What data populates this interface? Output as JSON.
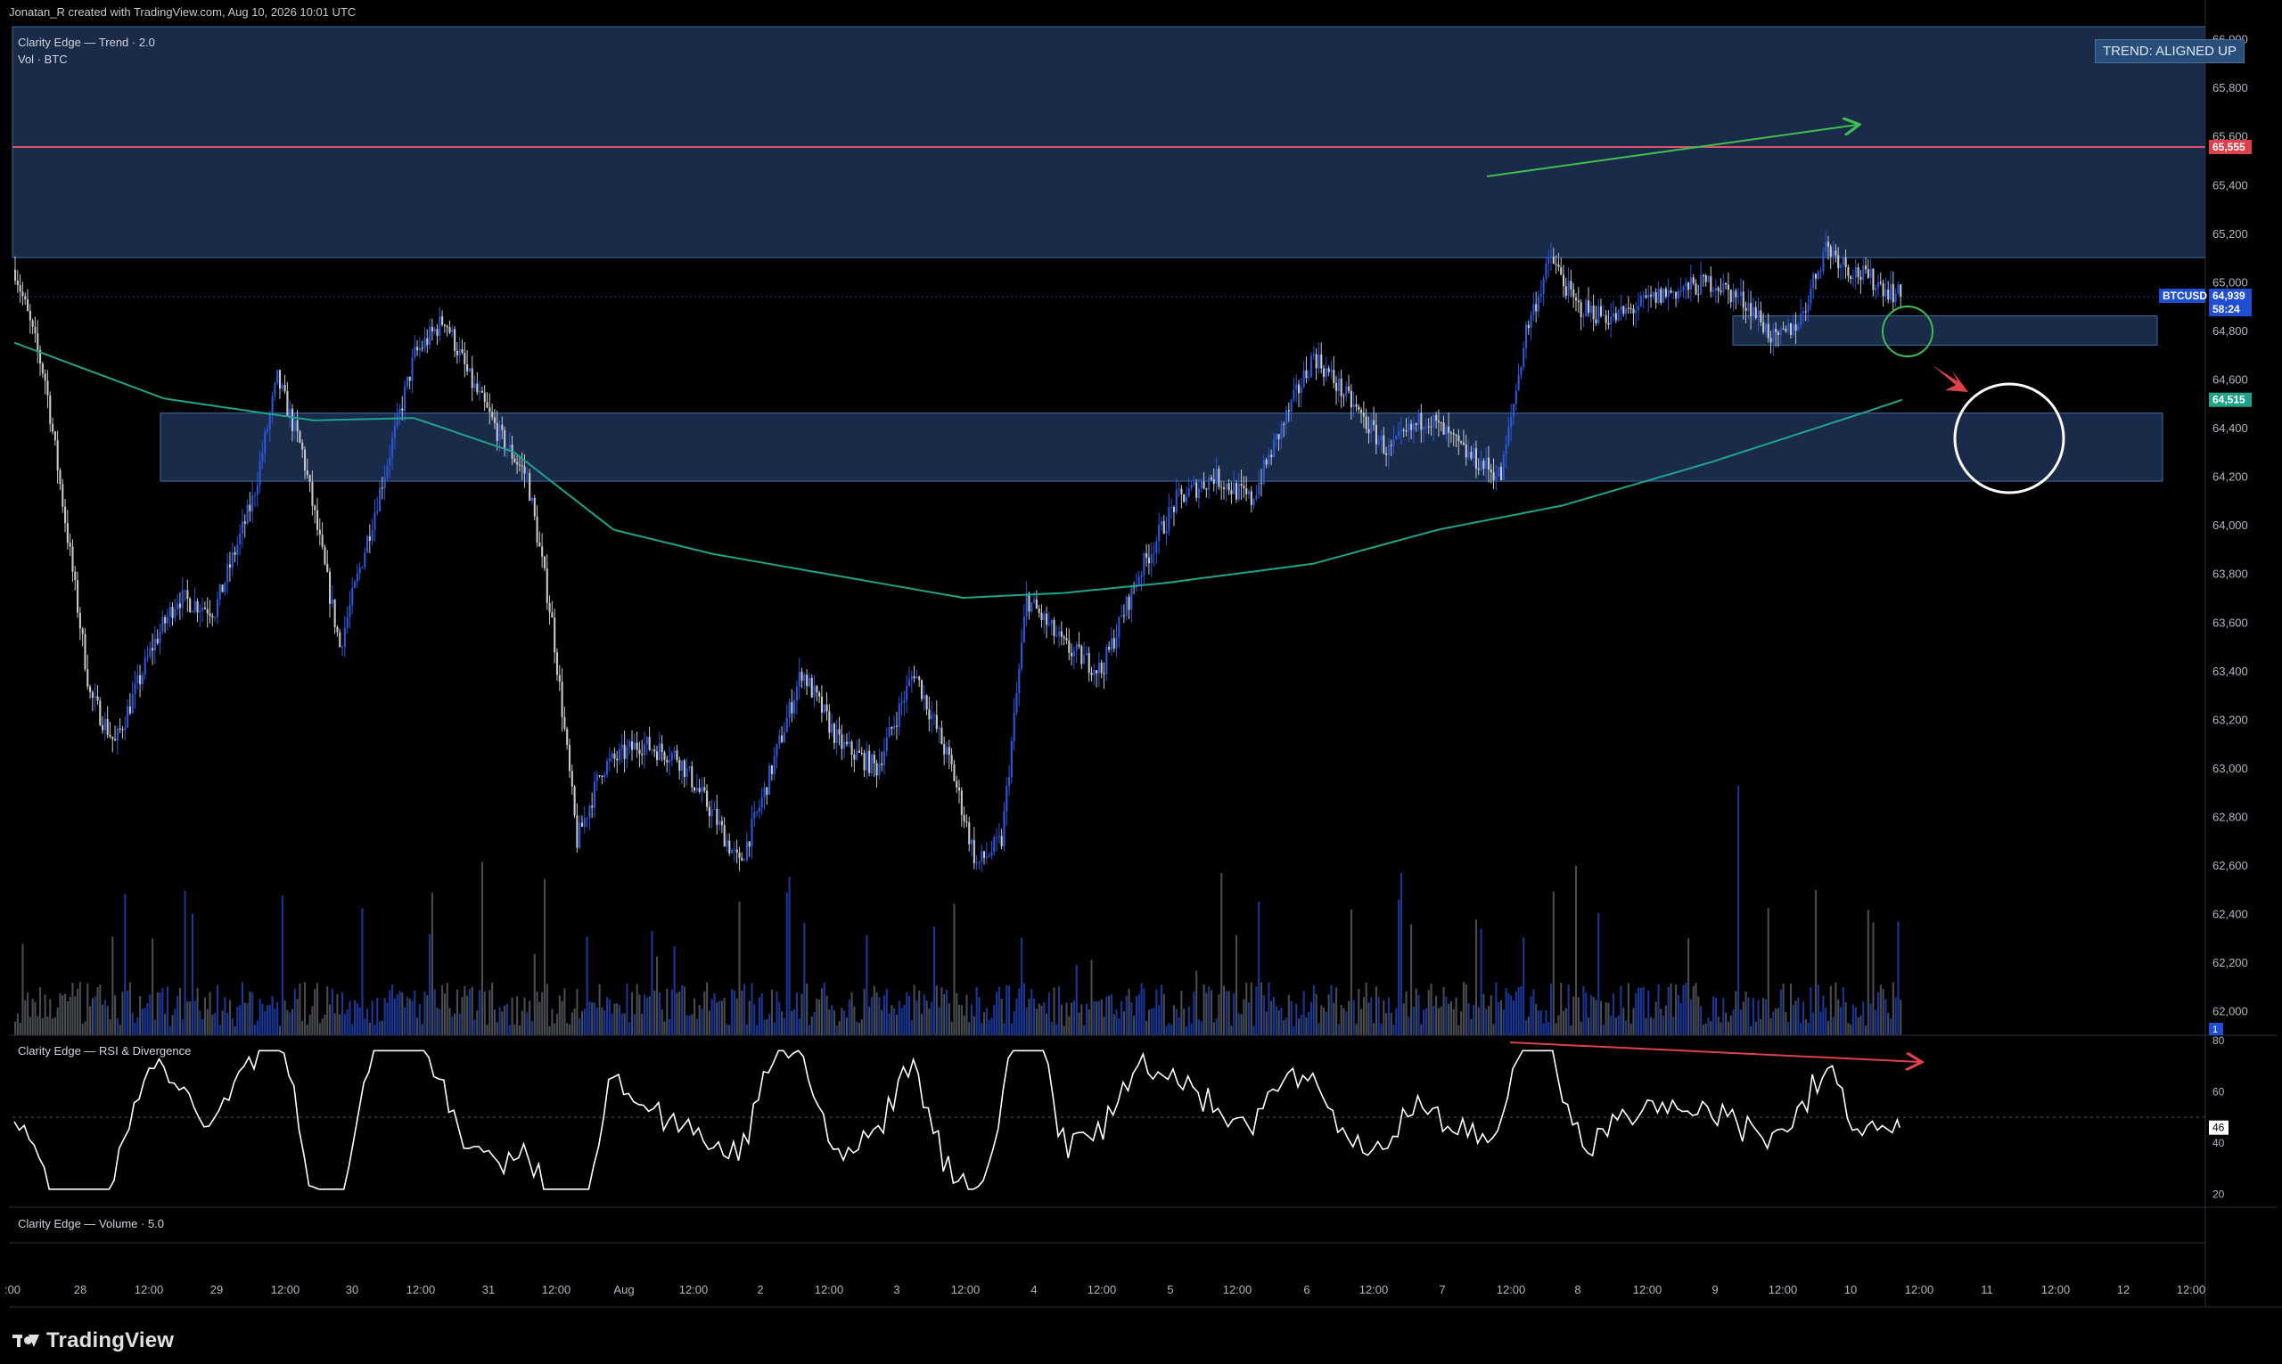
{
  "header": {
    "credit": "Jonatan_R created with TradingView.com, Aug 10, 2026 10:01 UTC"
  },
  "main_pane": {
    "indicator_label": "Clarity Edge — Trend · 2.0",
    "volume_label": "Vol · BTC",
    "trend_badge": "TREND: ALIGNED UP"
  },
  "rsi_pane": {
    "label": "Clarity Edge — RSI & Divergence"
  },
  "volume_pane": {
    "label": "Clarity Edge — Volume · 5.0"
  },
  "footer": {
    "brand": "TradingView"
  },
  "colors": {
    "background": "#000000",
    "bull_candle": "#2b57d8",
    "bear_candle": "#c8c8c8",
    "zone_fill": "#1b2f4f",
    "resistance_line": "#e0506a",
    "ma_line": "#1fa38a",
    "up_arrow": "#3fbf4f",
    "down_arrow": "#e0404a",
    "rsi_line": "#ffffff"
  },
  "price_tags": [
    {
      "label": "65,555",
      "bg": "#e0404a",
      "fg": "#ffffff"
    },
    {
      "label": "BTCUSD",
      "bg": "#1f4fd0",
      "fg": "#ffffff"
    },
    {
      "label": "64,939",
      "bg": "#1f4fd0",
      "fg": "#ffffff"
    },
    {
      "label": "58:24",
      "bg": "#1f4fd0",
      "fg": "#ffffff"
    },
    {
      "label": "64,515",
      "bg": "#1fa38a",
      "fg": "#ffffff"
    }
  ],
  "rsi_tag": "46",
  "volume_tag": "1",
  "chart_data": {
    "type": "candlestick",
    "symbol": "BTCUSD",
    "y_ticks": [
      "66,000",
      "65,800",
      "65,600",
      "65,400",
      "65,200",
      "65,000",
      "64,800",
      "64,600",
      "64,400",
      "64,200",
      "64,000",
      "63,800",
      "63,600",
      "63,400",
      "63,200",
      "63,000",
      "62,800",
      "62,600",
      "62,400",
      "62,200",
      "62,000"
    ],
    "ylim": [
      61900,
      66050
    ],
    "x_ticks": [
      ":00",
      "28",
      "12:00",
      "29",
      "12:00",
      "30",
      "12:00",
      "31",
      "12:00",
      "Aug",
      "12:00",
      "2",
      "12:00",
      "3",
      "12:00",
      "4",
      "12:00",
      "5",
      "12:00",
      "6",
      "12:00",
      "7",
      "12:00",
      "8",
      "12:00",
      "9",
      "12:00",
      "10",
      "12:00",
      "11",
      "12:00",
      "12",
      "12:00"
    ],
    "resistance_level": 65555,
    "last_price": 64939,
    "ma_value": 64515,
    "zones": [
      {
        "name": "upper-resistance-zone",
        "top": 66050,
        "bottom": 65100
      },
      {
        "name": "mid-support-zone",
        "top": 64460,
        "bottom": 64180
      },
      {
        "name": "retest-zone",
        "top": 64860,
        "bottom": 64740
      }
    ],
    "ma_path": [
      [
        0,
        64750
      ],
      [
        20,
        64740
      ],
      [
        40,
        64640
      ],
      [
        60,
        64560
      ],
      [
        80,
        64490
      ],
      [
        100,
        64440
      ],
      [
        120,
        64420
      ],
      [
        140,
        64430
      ],
      [
        155,
        64430
      ],
      [
        170,
        64370
      ],
      [
        190,
        64240
      ],
      [
        210,
        64100
      ],
      [
        230,
        63960
      ],
      [
        250,
        63880
      ],
      [
        270,
        63830
      ],
      [
        290,
        63800
      ],
      [
        310,
        63730
      ],
      [
        330,
        63660
      ],
      [
        345,
        63610
      ],
      [
        370,
        63620
      ],
      [
        400,
        63690
      ],
      [
        430,
        63800
      ],
      [
        460,
        63900
      ],
      [
        490,
        64050
      ],
      [
        520,
        64200
      ],
      [
        545,
        64320
      ],
      [
        575,
        64420
      ],
      [
        600,
        64490
      ],
      [
        610,
        64515
      ]
    ],
    "candles_count": 616,
    "volume_ticks": [],
    "rsi": {
      "ylim": [
        15,
        82
      ],
      "ticks": [
        "80",
        "60",
        "40",
        "20"
      ],
      "midline": 50,
      "last": 46
    }
  }
}
